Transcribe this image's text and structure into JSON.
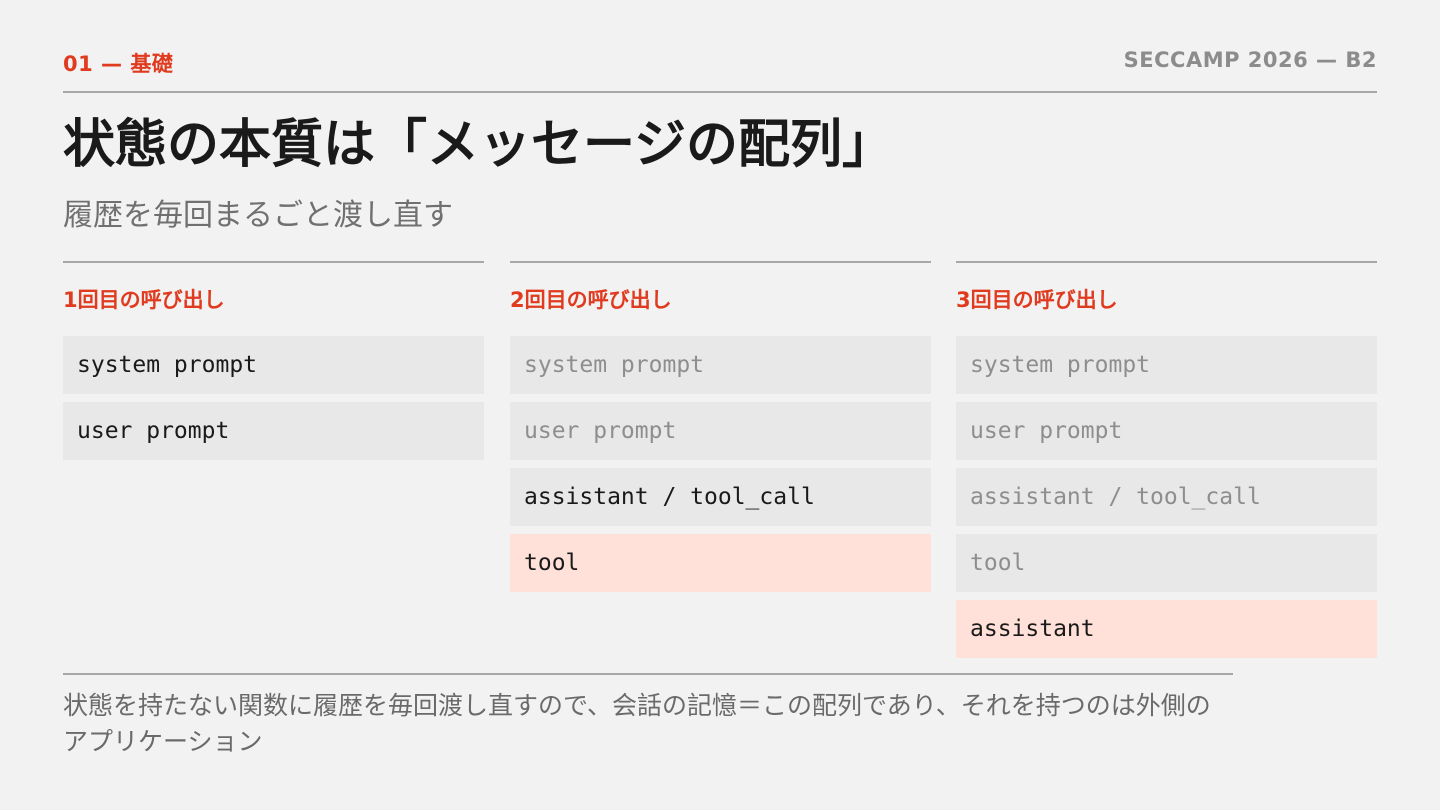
{
  "header": {
    "section": "01 — 基礎",
    "event": "SECCAMP 2026 — B2"
  },
  "title": "状態の本質は「メッセージの配列」",
  "subtitle": "履歴を毎回まるごと渡し直す",
  "columns": [
    {
      "heading": "1回目の呼び出し",
      "messages": [
        {
          "text": "system prompt",
          "state": "active"
        },
        {
          "text": "user prompt",
          "state": "active"
        }
      ]
    },
    {
      "heading": "2回目の呼び出し",
      "messages": [
        {
          "text": "system prompt",
          "state": "faded"
        },
        {
          "text": "user prompt",
          "state": "faded"
        },
        {
          "text": "assistant / tool_call",
          "state": "active"
        },
        {
          "text": "tool",
          "state": "new"
        }
      ]
    },
    {
      "heading": "3回目の呼び出し",
      "messages": [
        {
          "text": "system prompt",
          "state": "faded"
        },
        {
          "text": "user prompt",
          "state": "faded"
        },
        {
          "text": "assistant / tool_call",
          "state": "faded"
        },
        {
          "text": "tool",
          "state": "faded"
        },
        {
          "text": "assistant",
          "state": "new"
        }
      ]
    }
  ],
  "note": "状態を持たない関数に履歴を毎回渡し直すので、会話の記憶＝この配列であり、それを持つのは外側のアプリケーション",
  "colors": {
    "accent": "#e03a1f",
    "muted": "#8c8c8c",
    "message_bg": "#e8e8e8",
    "message_new_bg": "#ffe1d9",
    "background": "#f2f2f2"
  }
}
